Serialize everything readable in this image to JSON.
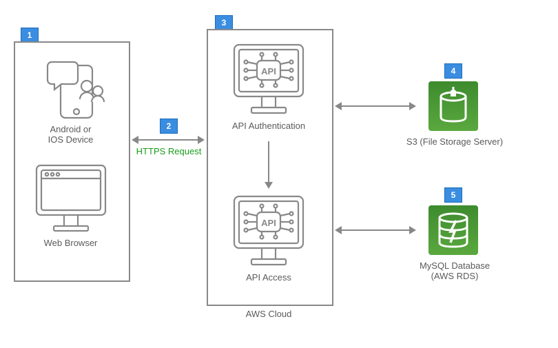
{
  "badges": {
    "b1": "1",
    "b2": "2",
    "b3": "3",
    "b4": "4",
    "b5": "5"
  },
  "clients": {
    "mobile": "Android or\nIOS Device",
    "web": "Web Browser"
  },
  "request": "HTTPS Request",
  "cloud": {
    "auth": "API Authentication",
    "access": "API Access",
    "title": "AWS Cloud"
  },
  "storage": "S3 (File Storage Server)",
  "db": "MySQL Database\n(AWS RDS)"
}
